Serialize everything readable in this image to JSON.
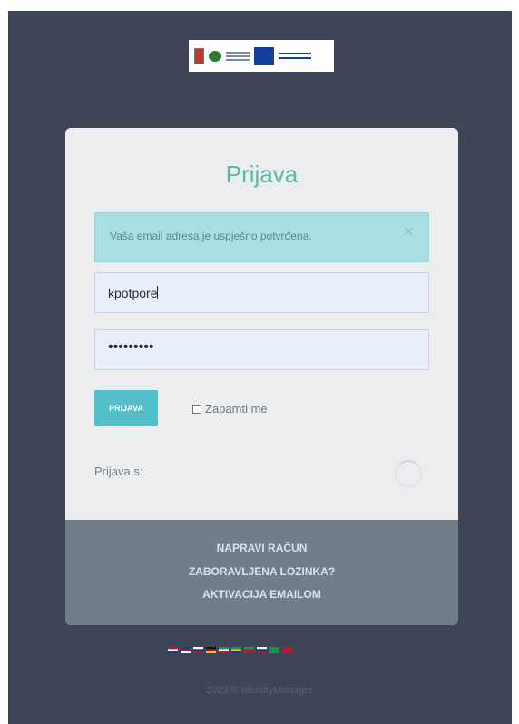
{
  "header": {
    "logos": [
      "croatia-crest-logo",
      "esf-fund-logo",
      "eu-flag-logo"
    ]
  },
  "login": {
    "title": "Prijava",
    "alert": {
      "message": "Vaša email adresa je uspješno potvrđena.",
      "close": "×"
    },
    "username": {
      "value": "kpotpore"
    },
    "password": {
      "value": "•••••••••"
    },
    "submit_label": "PRIJAVA",
    "remember_label": "Zapamti me",
    "social_label": "Prijava s:"
  },
  "footer": {
    "links": [
      "NAPRAVI RAČUN",
      "ZABORAVLJENA LOZINKA?",
      "AKTIVACIJA EMAILOM"
    ]
  },
  "languages": [
    {
      "name": "flag-hr-icon",
      "colors": [
        "#c8102e",
        "#ffffff",
        "#1b3c8c"
      ]
    },
    {
      "name": "flag-gb-icon",
      "colors": [
        "#1b3c8c",
        "#c8102e",
        "#ffffff"
      ]
    },
    {
      "name": "flag-si-icon",
      "colors": [
        "#ffffff",
        "#1b3c8c",
        "#c8102e"
      ]
    },
    {
      "name": "flag-de-icon",
      "colors": [
        "#111111",
        "#c8102e",
        "#f2c500"
      ]
    },
    {
      "name": "flag-it-icon",
      "colors": [
        "#119b45",
        "#ffffff",
        "#c8102e"
      ]
    },
    {
      "name": "flag-br-icon",
      "colors": [
        "#119b45",
        "#f2c500",
        "#1b3c8c"
      ]
    },
    {
      "name": "flag-pt-icon",
      "colors": [
        "#119b45",
        "#c8102e",
        "#c8102e"
      ]
    },
    {
      "name": "flag-ru-icon",
      "colors": [
        "#ffffff",
        "#1b3c8c",
        "#c8102e"
      ]
    },
    {
      "name": "flag-sa-icon",
      "colors": [
        "#119b45",
        "#119b45",
        "#119b45"
      ]
    },
    {
      "name": "flag-cn-icon",
      "colors": [
        "#c8102e",
        "#c8102e",
        "#c8102e"
      ]
    }
  ],
  "copyright": "2023 © IdentityManager"
}
